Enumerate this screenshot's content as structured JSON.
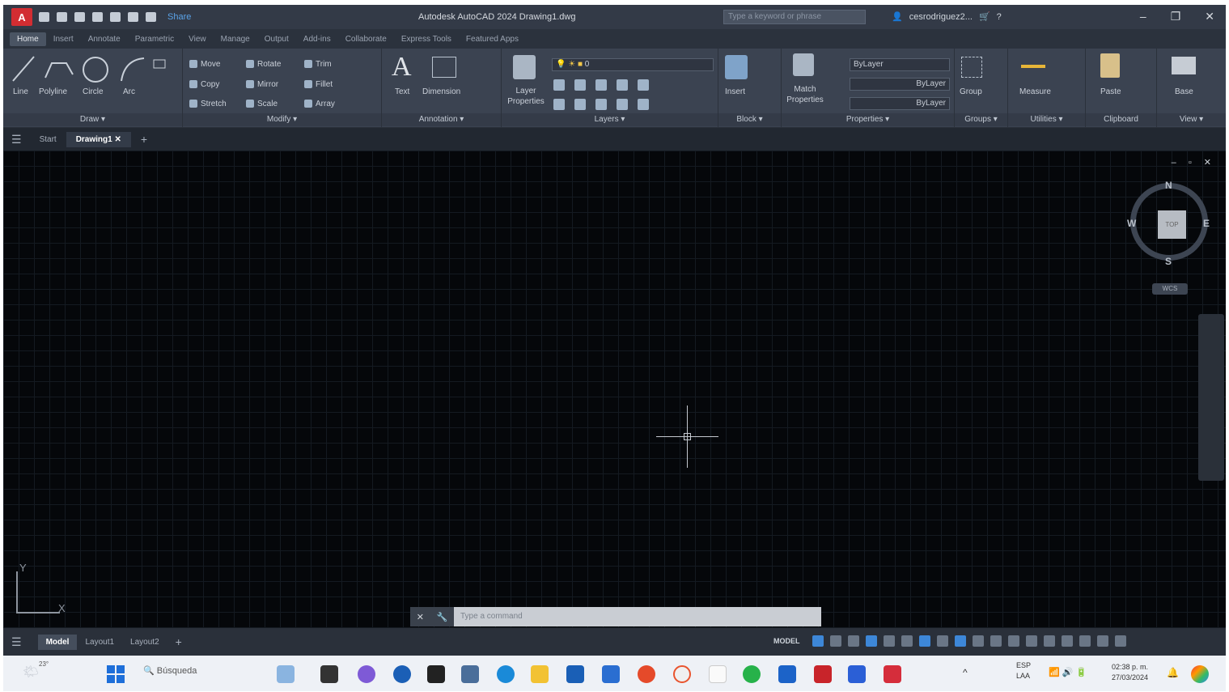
{
  "titlebar": {
    "logo": "A",
    "share": "Share",
    "window_title": "Autodesk AutoCAD 2024   Drawing1.dwg",
    "search_placeholder": "Type a keyword or phrase",
    "user": "cesrodriguez2..."
  },
  "ribbon_tabs": [
    "Home",
    "Insert",
    "Annotate",
    "Parametric",
    "View",
    "Manage",
    "Output",
    "Add-ins",
    "Collaborate",
    "Express Tools",
    "Featured Apps"
  ],
  "ribbon": {
    "draw": {
      "title": "Draw ▾",
      "line": "Line",
      "polyline": "Polyline",
      "circle": "Circle",
      "arc": "Arc"
    },
    "modify": {
      "title": "Modify ▾",
      "move": "Move",
      "rotate": "Rotate",
      "trim": "Trim",
      "copy": "Copy",
      "mirror": "Mirror",
      "fillet": "Fillet",
      "stretch": "Stretch",
      "scale": "Scale",
      "array": "Array"
    },
    "annotation": {
      "title": "Annotation ▾",
      "text": "Text",
      "dimension": "Dimension"
    },
    "layers": {
      "title": "Layers ▾",
      "layer_properties": "Layer Properties",
      "current_layer": "0"
    },
    "block": {
      "title": "Block ▾",
      "insert": "Insert"
    },
    "properties": {
      "title": "Properties ▾",
      "match": "Match Properties",
      "color": "ByLayer",
      "linetype": "ByLayer",
      "lineweight": "ByLayer"
    },
    "groups": {
      "title": "Groups ▾",
      "group": "Group"
    },
    "utilities": {
      "title": "Utilities ▾",
      "measure": "Measure"
    },
    "clipboard": {
      "title": "Clipboard",
      "paste": "Paste"
    },
    "view": {
      "title": "View ▾",
      "base": "Base"
    }
  },
  "doc_tabs": {
    "start": "Start",
    "drawing": "Drawing1",
    "close": "✕",
    "add": "+"
  },
  "viewport": {
    "controls": "– ▫ ✕",
    "cube_face": "TOP",
    "north": "N",
    "south": "S",
    "east": "E",
    "west": "W",
    "wcs": "WCS"
  },
  "ucs": {
    "x": "X",
    "y": "Y"
  },
  "command": {
    "placeholder": "Type a command",
    "close": "✕",
    "wrench": "🔧"
  },
  "layout_tabs": {
    "model": "Model",
    "layout1": "Layout1",
    "layout2": "Layout2",
    "add": "+"
  },
  "status": {
    "model": "MODEL"
  },
  "taskbar": {
    "search": "Búsqueda",
    "lang_top": "ESP",
    "lang_bottom": "LAA",
    "time": "02:38 p. m.",
    "date": "27/03/2024",
    "weather": "23°"
  }
}
